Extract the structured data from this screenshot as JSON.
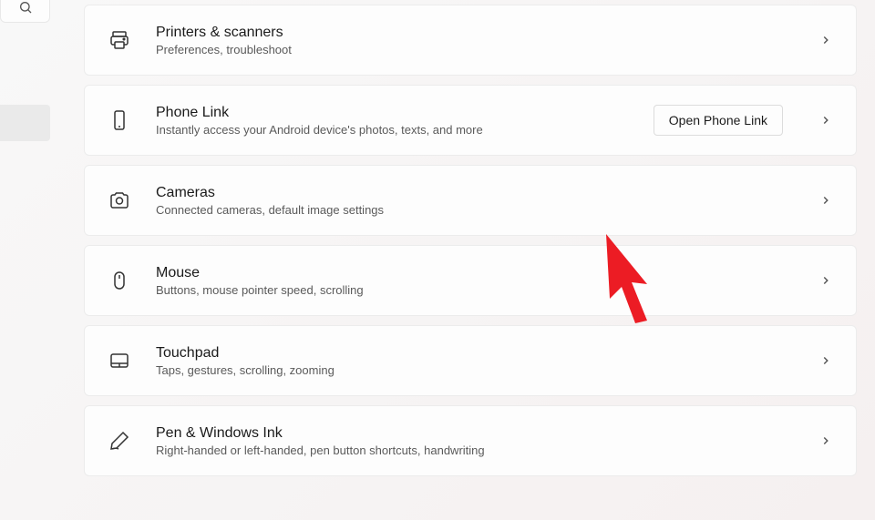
{
  "items": [
    {
      "id": "printers",
      "title": "Printers & scanners",
      "desc": "Preferences, troubleshoot",
      "icon": "printer-icon",
      "button": null
    },
    {
      "id": "phonelink",
      "title": "Phone Link",
      "desc": "Instantly access your Android device's photos, texts, and more",
      "icon": "phone-icon",
      "button": "Open Phone Link"
    },
    {
      "id": "cameras",
      "title": "Cameras",
      "desc": "Connected cameras, default image settings",
      "icon": "camera-icon",
      "button": null
    },
    {
      "id": "mouse",
      "title": "Mouse",
      "desc": "Buttons, mouse pointer speed, scrolling",
      "icon": "mouse-icon",
      "button": null
    },
    {
      "id": "touchpad",
      "title": "Touchpad",
      "desc": "Taps, gestures, scrolling, zooming",
      "icon": "touchpad-icon",
      "button": null
    },
    {
      "id": "pen",
      "title": "Pen & Windows Ink",
      "desc": "Right-handed or left-handed, pen button shortcuts, handwriting",
      "icon": "pen-icon",
      "button": null
    }
  ]
}
